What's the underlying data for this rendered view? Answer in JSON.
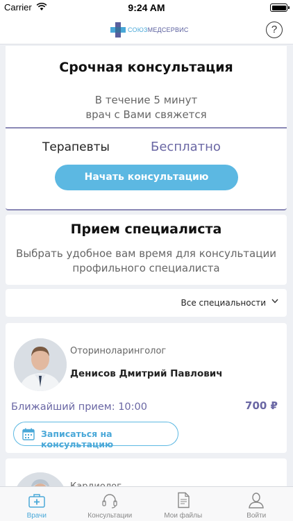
{
  "status_bar": {
    "carrier": "Carrier",
    "time": "9:24 AM"
  },
  "nav": {
    "logo_text_1": "СОЮЗ",
    "logo_text_2": "МЕДСЕРВИС",
    "help_symbol": "?"
  },
  "urgent": {
    "title": "Срочная консультация",
    "subtitle_line1": "В течение 5 минут",
    "subtitle_line2": "врач с Вами свяжется",
    "category": "Терапевты",
    "price": "Бесплатно",
    "button": "Начать консультацию"
  },
  "specialist": {
    "title": "Прием специалиста",
    "subtitle_line1": "Выбрать удобное вам время для консультации",
    "subtitle_line2": "профильного специалиста"
  },
  "filter": {
    "label": "Все специальности"
  },
  "doctors": [
    {
      "specialty": "Оториноларинголог",
      "name": "Денисов Дмитрий Павлович",
      "nearest": "Ближайший прием: 10:00",
      "price": "700 ₽",
      "book_button": "Записаться на консультацию"
    },
    {
      "specialty": "Кардиолог"
    }
  ],
  "tabs": [
    {
      "label": "Врачи",
      "icon": "doctor-bag-icon",
      "active": true
    },
    {
      "label": "Консультации",
      "icon": "headset-icon",
      "active": false
    },
    {
      "label": "Мои файлы",
      "icon": "file-icon",
      "active": false
    },
    {
      "label": "Войти",
      "icon": "person-icon",
      "active": false
    }
  ],
  "colors": {
    "accent_blue": "#5cb8e2",
    "accent_purple": "#6a67a4",
    "background": "#eef0f4"
  }
}
